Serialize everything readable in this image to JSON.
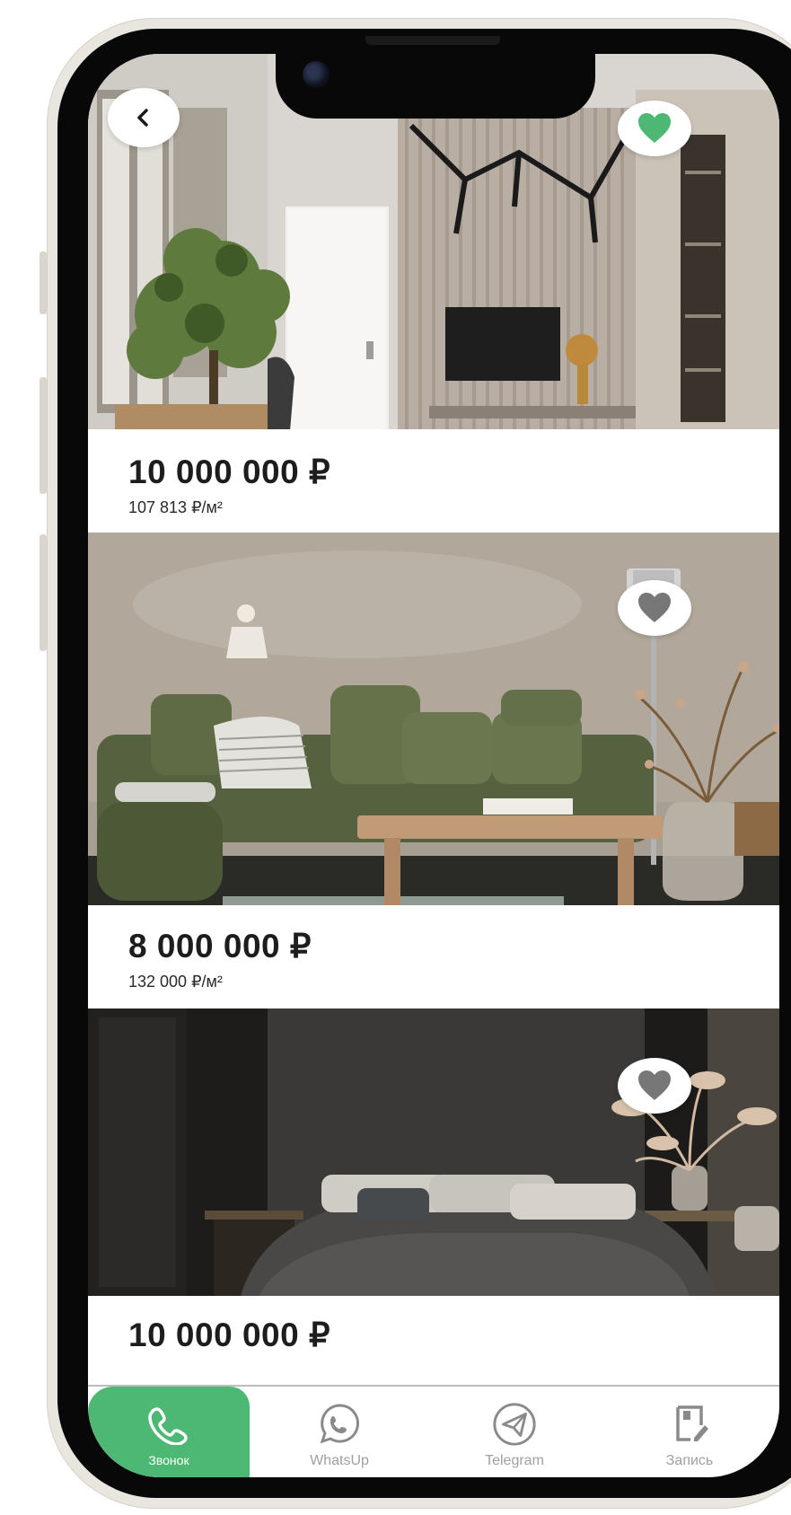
{
  "listings": [
    {
      "price": "10 000 000 ₽",
      "price_per_m2": "107 813 ₽/м²",
      "favorite": true
    },
    {
      "price": "8 000 000 ₽",
      "price_per_m2": "132 000 ₽/м²",
      "favorite": false
    },
    {
      "price": "10 000 000 ₽",
      "price_per_m2": "",
      "favorite": false
    }
  ],
  "bottom_nav": {
    "items": [
      {
        "label": "Звонок",
        "icon": "phone-icon",
        "active": true
      },
      {
        "label": "WhatsUp",
        "icon": "whatsapp-icon",
        "active": false
      },
      {
        "label": "Telegram",
        "icon": "telegram-icon",
        "active": false
      },
      {
        "label": "Запись",
        "icon": "edit-note-icon",
        "active": false
      }
    ]
  },
  "colors": {
    "accent": "#4db874",
    "favorite_active": "#4db874",
    "favorite_inactive": "#777777",
    "text_dark": "#1d1d1d",
    "nav_label": "#a0a0a0"
  }
}
